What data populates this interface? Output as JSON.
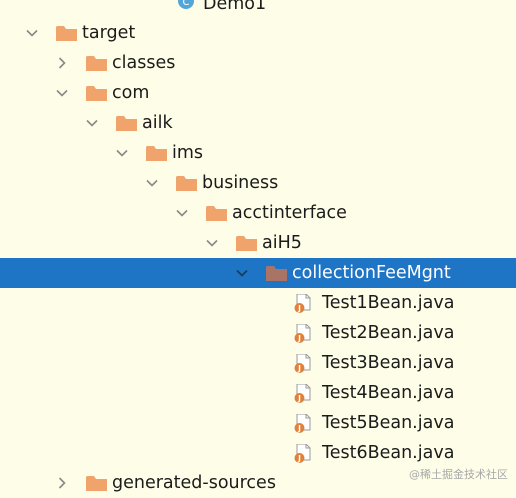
{
  "tree": {
    "items": [
      {
        "label": "Demo1",
        "type": "class",
        "expanded": null
      },
      {
        "label": "target",
        "type": "folder",
        "expanded": true
      },
      {
        "label": "classes",
        "type": "folder",
        "expanded": false
      },
      {
        "label": "com",
        "type": "folder",
        "expanded": true
      },
      {
        "label": "ailk",
        "type": "folder",
        "expanded": true
      },
      {
        "label": "ims",
        "type": "folder",
        "expanded": true
      },
      {
        "label": "business",
        "type": "folder",
        "expanded": true
      },
      {
        "label": "acctinterface",
        "type": "folder",
        "expanded": true
      },
      {
        "label": "aiH5",
        "type": "folder",
        "expanded": true
      },
      {
        "label": "collectionFeeMgnt",
        "type": "folder",
        "expanded": true,
        "selected": true
      },
      {
        "label": "Test1Bean.java",
        "type": "java-file",
        "expanded": null
      },
      {
        "label": "Test2Bean.java",
        "type": "java-file",
        "expanded": null
      },
      {
        "label": "Test3Bean.java",
        "type": "java-file",
        "expanded": null
      },
      {
        "label": "Test4Bean.java",
        "type": "java-file",
        "expanded": null
      },
      {
        "label": "Test5Bean.java",
        "type": "java-file",
        "expanded": null
      },
      {
        "label": "Test6Bean.java",
        "type": "java-file",
        "expanded": null
      },
      {
        "label": "generated-sources",
        "type": "folder",
        "expanded": false
      }
    ]
  },
  "icons": {
    "folder": "folder-icon",
    "folder_selected": "folder-icon",
    "java_file": "java-file-icon",
    "class": "class-icon",
    "expanded": "chevron-down-icon",
    "collapsed": "chevron-right-icon"
  },
  "colors": {
    "background": "#fefde8",
    "selection": "#1e75c6",
    "folder": "#f0a46c",
    "folder_selected": "#a97466",
    "chevron": "#888888",
    "text": "#1b1b1b",
    "selected_text": "#ffffff",
    "java_badge": "#e0803a",
    "class_badge": "#55a6d8"
  },
  "watermark": "@稀土掘金技术社区"
}
